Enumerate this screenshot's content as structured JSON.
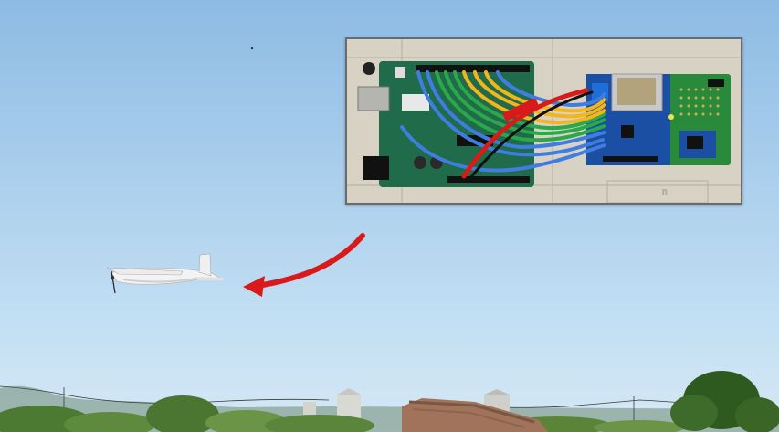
{
  "scene": {
    "sky_top_color": "#8fbde6",
    "sky_bottom_color": "#cfe4f4",
    "arrow_color": "#d91a1a",
    "vegetation_color": "#3d6b2a"
  },
  "inset": {
    "board_color": "#1f6b4a",
    "module_color": "#1b4fa3",
    "wire_colors": [
      "#3f7ee0",
      "#2aa84a",
      "#f2b51b",
      "#d91a1a",
      "#111111"
    ]
  }
}
